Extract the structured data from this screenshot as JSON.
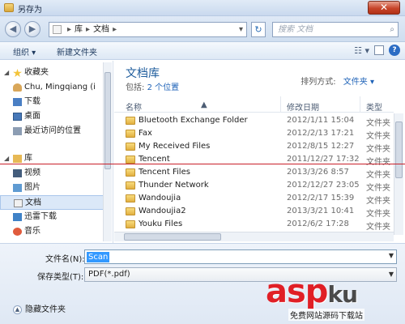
{
  "window": {
    "title": "另存为",
    "close_glyph": "✕"
  },
  "address": {
    "back_glyph": "◀",
    "forward_glyph": "▶",
    "crumbs": [
      "库",
      "文档"
    ],
    "refresh_glyph": "↻",
    "search_placeholder": "搜索 文档"
  },
  "toolbar": {
    "organize": "组织 ▾",
    "new_folder": "新建文件夹",
    "help": "?"
  },
  "nav": {
    "favorites": "收藏夹",
    "items": [
      {
        "label": "Chu, Mingqiang (i",
        "icon": "user-icon"
      },
      {
        "label": "下载",
        "icon": "download-icon"
      },
      {
        "label": "桌面",
        "icon": "desktop-icon"
      },
      {
        "label": "最近访问的位置",
        "icon": "recent-places-icon"
      }
    ],
    "libraries": "库",
    "lib_items": [
      {
        "label": "视频",
        "icon": "video-icon"
      },
      {
        "label": "图片",
        "icon": "pictures-icon"
      },
      {
        "label": "文档",
        "icon": "documents-icon"
      },
      {
        "label": "迅雷下载",
        "icon": "xunlei-icon"
      },
      {
        "label": "音乐",
        "icon": "music-icon"
      }
    ]
  },
  "main": {
    "library_title": "文档库",
    "includes_prefix": "包括:",
    "includes_link": "2 个位置",
    "arrange_label": "排列方式:",
    "arrange_value": "文件夹 ▾",
    "columns": {
      "name": "名称",
      "modified": "修改日期",
      "type": "类型"
    },
    "rows": [
      {
        "name": "Bluetooth Exchange Folder",
        "date": "2012/1/11 15:04",
        "type": "文件夹"
      },
      {
        "name": "Fax",
        "date": "2012/2/13 17:21",
        "type": "文件夹"
      },
      {
        "name": "My Received Files",
        "date": "2012/8/15 12:27",
        "type": "文件夹"
      },
      {
        "name": "Tencent",
        "date": "2011/12/27 17:32",
        "type": "文件夹"
      },
      {
        "name": "Tencent Files",
        "date": "2013/3/26 8:57",
        "type": "文件夹"
      },
      {
        "name": "Thunder Network",
        "date": "2012/12/27 23:05",
        "type": "文件夹"
      },
      {
        "name": "Wandoujia",
        "date": "2012/2/17 15:39",
        "type": "文件夹"
      },
      {
        "name": "Wandoujia2",
        "date": "2013/3/21 10:41",
        "type": "文件夹"
      },
      {
        "name": "Youku Files",
        "date": "2012/6/2 17:28",
        "type": "文件夹"
      }
    ]
  },
  "form": {
    "filename_label": "文件名(N):",
    "filename_value": "Scan",
    "filetype_label": "保存类型(T):",
    "filetype_value": "PDF(*.pdf)",
    "hide_folders": "隐藏文件夹",
    "hide_glyph": "▲"
  },
  "watermark": {
    "brand": "asp",
    "brand_tail": "ku",
    "tagline": "免费网站源码下载站"
  },
  "colors": {
    "accent": "#1e5c9c",
    "link": "#1f63b8",
    "selection": "#3399ff",
    "close": "#c7452a"
  }
}
